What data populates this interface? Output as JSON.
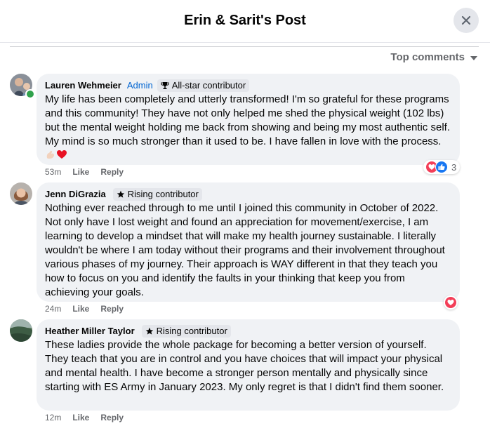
{
  "header": {
    "title": "Erin & Sarit's Post"
  },
  "sort": {
    "label": "Top comments"
  },
  "comments": [
    {
      "name": "Lauren Wehmeier",
      "role": "Admin",
      "badge": "All-star contributor",
      "text": "My life has been completely and utterly transformed! I'm so grateful for these programs and this community! They have not only helped me shed the physical weight (102 lbs) but the mental weight holding me back from showing and being my most authentic self. My mind is so much stronger than it used to be. I have fallen in love with the process.",
      "time": "53m",
      "like": "Like",
      "reply": "Reply",
      "reaction_count": "3"
    },
    {
      "name": "Jenn DiGrazia",
      "badge": "Rising contributor",
      "text": "Nothing ever reached through to me until I joined this community in October of 2022. Not only have I lost weight and found an appreciation for movement/exercise, I am learning to develop a mindset that will make my health journey sustainable. I literally wouldn't be where I am today without their programs and their involvement throughout various phases of my journey. Their approach is WAY different in that they teach you how to focus on you and identify the faults in your thinking that keep you from achieving your goals.",
      "time": "24m",
      "like": "Like",
      "reply": "Reply"
    },
    {
      "name": "Heather Miller Taylor",
      "badge": "Rising contributor",
      "text": "These ladies provide the whole package for becoming a better version of yourself. They teach that you are in control and you have choices that will impact your physical and mental health. I have become a stronger person mentally and physically since starting with ES Army in January 2023. My only regret is that I didn't find them sooner.",
      "time": "12m",
      "like": "Like",
      "reply": "Reply"
    }
  ]
}
